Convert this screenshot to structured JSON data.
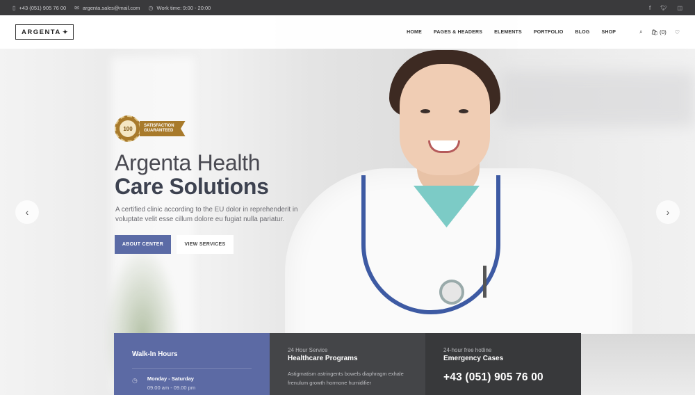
{
  "topbar": {
    "phone": "+43 (051) 905 76 00",
    "email": "argenta.sales@mail.com",
    "hours": "Work time: 9:00 - 20:00",
    "social": [
      "f",
      "t",
      "ig"
    ]
  },
  "header": {
    "logo": "ARGENTA",
    "nav": [
      "HOME",
      "PAGES & HEADERS",
      "ELEMENTS",
      "PORTFOLIO",
      "BLOG",
      "SHOP"
    ],
    "cart_count": "(0)"
  },
  "hero": {
    "badge_number": "100",
    "badge_text_line1": "SATISFACTION",
    "badge_text_line2": "GUARANTEED",
    "title_line1": "Argenta Health",
    "title_line2": "Care Solutions",
    "description": "A certified clinic according to the EU dolor in reprehenderit in voluptate velit esse cillum dolore eu fugiat nulla pariatur.",
    "btn_primary": "ABOUT CENTER",
    "btn_secondary": "VIEW SERVICES"
  },
  "boxes": {
    "walkin": {
      "title": "Walk-In Hours",
      "days": "Monday - Saturday",
      "time": "09.00 am - 09.00 pm"
    },
    "service": {
      "label": "24 Hour Service",
      "title": "Healthcare Programs",
      "text": "Astigmatism astringents bowels diaphragm exhale frenulum growth hormone humidifier"
    },
    "hotline": {
      "label": "24-hour free hotline",
      "title": "Emergency Cases",
      "phone": "+43 (051) 905 76 00"
    }
  },
  "colors": {
    "accent": "#5b6ba6",
    "badge_gold": "#a87a2b",
    "topbar": "#3a3a3c"
  }
}
